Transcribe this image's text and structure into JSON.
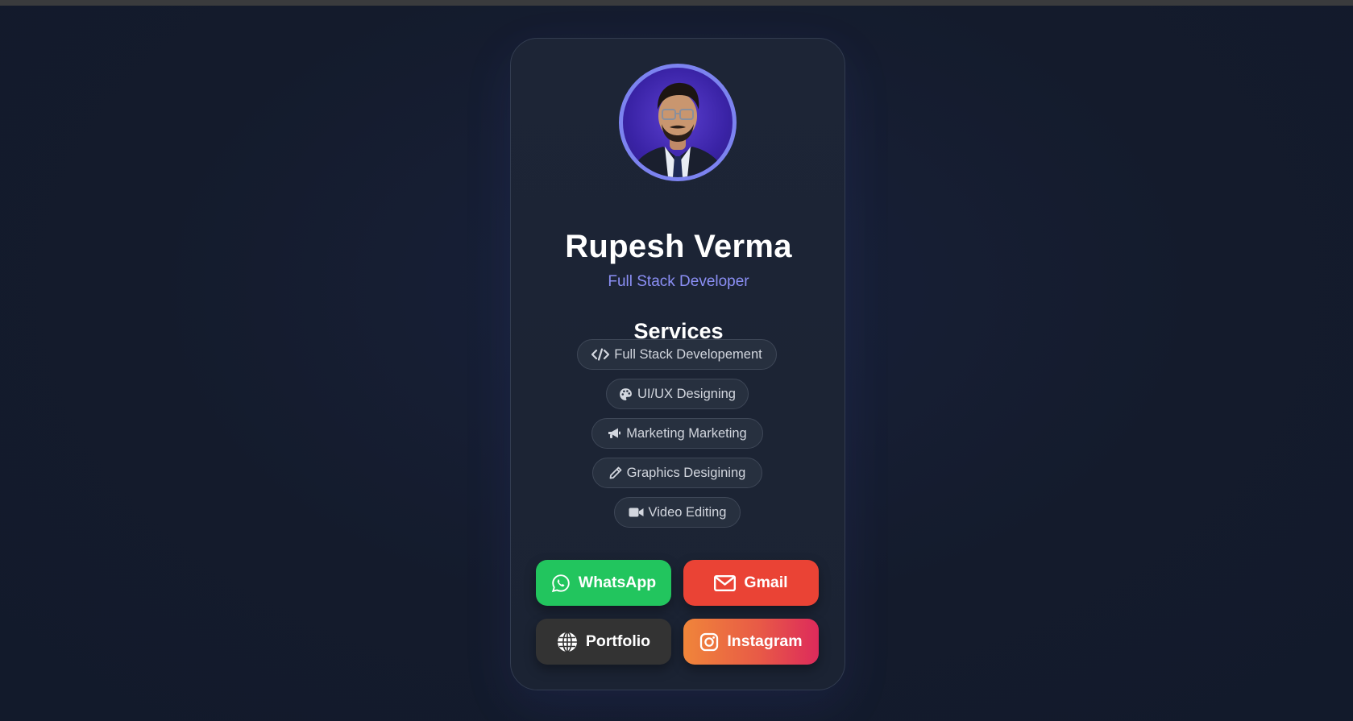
{
  "profile": {
    "name": "Rupesh Verma",
    "role": "Full Stack Developer"
  },
  "services": {
    "title": "Services",
    "items": [
      {
        "label": "Full Stack Developement",
        "icon": "code-icon"
      },
      {
        "label": "UI/UX Designing",
        "icon": "palette-icon"
      },
      {
        "label": "Marketing Marketing",
        "icon": "megaphone-icon"
      },
      {
        "label": "Graphics Desigining",
        "icon": "pencil-icon"
      },
      {
        "label": "Video Editing",
        "icon": "video-camera-icon"
      }
    ]
  },
  "links": {
    "whatsapp": {
      "label": "WhatsApp",
      "icon": "whatsapp-icon",
      "color": "#22c55e"
    },
    "gmail": {
      "label": "Gmail",
      "icon": "envelope-icon",
      "color": "#ea4335"
    },
    "portfolio": {
      "label": "Portfolio",
      "icon": "globe-icon",
      "color": "#333333"
    },
    "instagram": {
      "label": "Instagram",
      "icon": "instagram-icon",
      "color": "#e1306c"
    }
  },
  "colors": {
    "accent": "#7c83f0",
    "background": "#141b2c",
    "card": "#1d2536"
  }
}
